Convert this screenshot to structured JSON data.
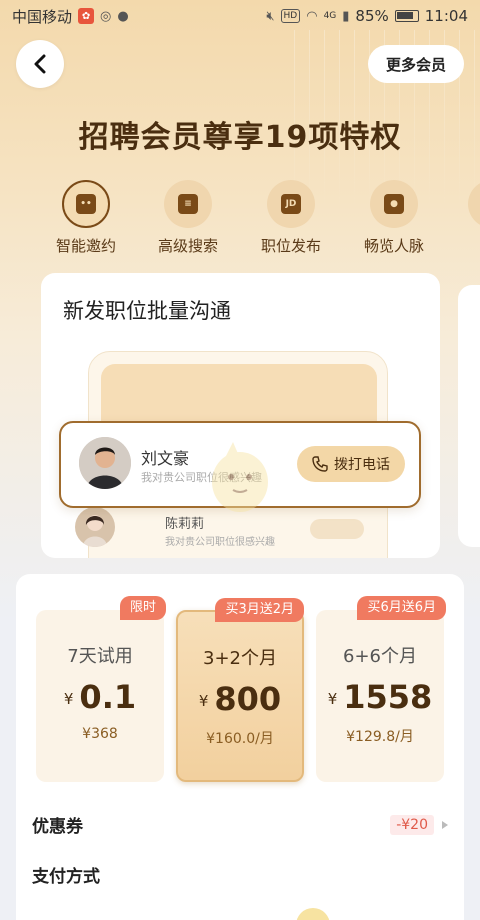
{
  "status_bar": {
    "carrier": "中国移动",
    "hd": "HD",
    "signal": "4G",
    "battery": "85%",
    "time": "11:04"
  },
  "header": {
    "more_members": "更多会员",
    "title": "招聘会员尊享19项特权"
  },
  "privileges": [
    {
      "label": "智能邀约",
      "icon": "chat-robot-icon",
      "icon_text": "••"
    },
    {
      "label": "高级搜索",
      "icon": "search-list-icon",
      "icon_text": "≡"
    },
    {
      "label": "职位发布",
      "icon": "jd-briefcase-icon",
      "icon_text": "JD"
    },
    {
      "label": "畅览人脉",
      "icon": "person-icon",
      "icon_text": "●"
    }
  ],
  "feature": {
    "title": "新发职位批量沟通",
    "candidate1": {
      "name": "刘文豪",
      "message": "我对贵公司职位很感兴趣"
    },
    "call_button": "拨打电话",
    "candidate2": {
      "name": "陈莉莉",
      "message": "我对贵公司职位很感兴趣"
    }
  },
  "plans": [
    {
      "badge": "限时",
      "name": "7天试用",
      "currency": "¥",
      "price": "0.1",
      "unit": "¥368"
    },
    {
      "badge": "买3月送2月",
      "name": "3+2个月",
      "currency": "¥",
      "price": "800",
      "unit": "¥160.0/月",
      "selected": true
    },
    {
      "badge": "买6月送6月",
      "name": "6+6个月",
      "currency": "¥",
      "price": "1558",
      "unit": "¥129.8/月"
    }
  ],
  "coupon": {
    "label": "优惠券",
    "value": "-¥20"
  },
  "payment": {
    "label": "支付方式"
  },
  "colors": {
    "accent": "#4a2e10",
    "badge": "#f07a60",
    "gold": "#f3d7a7"
  }
}
